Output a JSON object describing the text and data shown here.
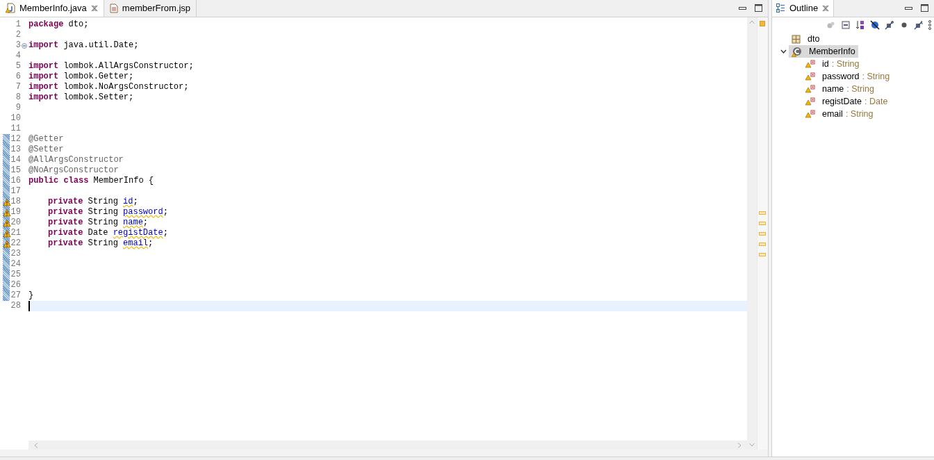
{
  "editor": {
    "tabs": [
      {
        "label": "MemberInfo.java",
        "kind": "java",
        "selected": true,
        "closable": true
      },
      {
        "label": "memberFrom.jsp",
        "kind": "jsp",
        "selected": false,
        "closable": false
      }
    ],
    "lines": [
      {
        "number": "1",
        "tokens": [
          {
            "kind": "keyword",
            "text": "package"
          },
          {
            "kind": "plain",
            "text": " dto;"
          }
        ]
      },
      {
        "number": "2"
      },
      {
        "number": "3",
        "fold": true,
        "tokens": [
          {
            "kind": "keyword",
            "text": "import"
          },
          {
            "kind": "plain",
            "text": " java.util.Date;"
          }
        ]
      },
      {
        "number": "4"
      },
      {
        "number": "5",
        "tokens": [
          {
            "kind": "keyword",
            "text": "import"
          },
          {
            "kind": "plain",
            "text": " lombok.AllArgsConstructor;"
          }
        ]
      },
      {
        "number": "6",
        "tokens": [
          {
            "kind": "keyword",
            "text": "import"
          },
          {
            "kind": "plain",
            "text": " lombok.Getter;"
          }
        ]
      },
      {
        "number": "7",
        "tokens": [
          {
            "kind": "keyword",
            "text": "import"
          },
          {
            "kind": "plain",
            "text": " lombok.NoArgsConstructor;"
          }
        ]
      },
      {
        "number": "8",
        "tokens": [
          {
            "kind": "keyword",
            "text": "import"
          },
          {
            "kind": "plain",
            "text": " lombok.Setter;"
          }
        ]
      },
      {
        "number": "9"
      },
      {
        "number": "10"
      },
      {
        "number": "11"
      },
      {
        "number": "12",
        "changed": true,
        "tokens": [
          {
            "kind": "annotation",
            "text": "@Getter"
          }
        ]
      },
      {
        "number": "13",
        "changed": true,
        "tokens": [
          {
            "kind": "annotation",
            "text": "@Setter"
          }
        ]
      },
      {
        "number": "14",
        "changed": true,
        "tokens": [
          {
            "kind": "annotation",
            "text": "@AllArgsConstructor"
          }
        ]
      },
      {
        "number": "15",
        "changed": true,
        "tokens": [
          {
            "kind": "annotation",
            "text": "@NoArgsConstructor"
          }
        ]
      },
      {
        "number": "16",
        "changed": true,
        "tokens": [
          {
            "kind": "keyword",
            "text": "public class"
          },
          {
            "kind": "plain",
            "text": " MemberInfo {"
          }
        ]
      },
      {
        "number": "17",
        "changed": true
      },
      {
        "number": "18",
        "changed": true,
        "warning": true,
        "indent": true,
        "tokens": [
          {
            "kind": "keyword",
            "text": "private"
          },
          {
            "kind": "plain",
            "text": " String "
          },
          {
            "kind": "field",
            "text": "id"
          },
          {
            "kind": "plain",
            "text": ";"
          }
        ]
      },
      {
        "number": "19",
        "changed": true,
        "warning": true,
        "indent": true,
        "tokens": [
          {
            "kind": "keyword",
            "text": "private"
          },
          {
            "kind": "plain",
            "text": " String "
          },
          {
            "kind": "field",
            "text": "password"
          },
          {
            "kind": "plain",
            "text": ";"
          }
        ]
      },
      {
        "number": "20",
        "changed": true,
        "warning": true,
        "indent": true,
        "tokens": [
          {
            "kind": "keyword",
            "text": "private"
          },
          {
            "kind": "plain",
            "text": " String "
          },
          {
            "kind": "field",
            "text": "name"
          },
          {
            "kind": "plain",
            "text": ";"
          }
        ]
      },
      {
        "number": "21",
        "changed": true,
        "warning": true,
        "indent": true,
        "tokens": [
          {
            "kind": "keyword",
            "text": "private"
          },
          {
            "kind": "plain",
            "text": " Date "
          },
          {
            "kind": "field",
            "text": "registDate"
          },
          {
            "kind": "plain",
            "text": ";"
          }
        ]
      },
      {
        "number": "22",
        "changed": true,
        "warning": true,
        "indent": true,
        "tokens": [
          {
            "kind": "keyword",
            "text": "private"
          },
          {
            "kind": "plain",
            "text": " String "
          },
          {
            "kind": "field",
            "text": "email"
          },
          {
            "kind": "plain",
            "text": ";"
          }
        ]
      },
      {
        "number": "23",
        "changed": true
      },
      {
        "number": "24",
        "changed": true
      },
      {
        "number": "25",
        "changed": true
      },
      {
        "number": "26",
        "changed": true
      },
      {
        "number": "27",
        "changed": true,
        "tokens": [
          {
            "kind": "plain",
            "text": "}"
          }
        ]
      },
      {
        "number": "28",
        "current": true
      }
    ]
  },
  "outline": {
    "title": "Outline",
    "items": [
      {
        "kind": "package",
        "name": "dto",
        "selected": false
      },
      {
        "kind": "class",
        "name": "MemberInfo",
        "selected": true,
        "expanded": true,
        "warning": true,
        "children": [
          {
            "kind": "field",
            "name": "id",
            "type": ": String",
            "selected": false
          },
          {
            "kind": "field",
            "name": "password",
            "type": ": String",
            "selected": false
          },
          {
            "kind": "field",
            "name": "name",
            "type": ": String",
            "selected": false
          },
          {
            "kind": "field",
            "name": "registDate",
            "type": ": Date",
            "selected": false
          },
          {
            "kind": "field",
            "name": "email",
            "type": ": String",
            "selected": false
          }
        ]
      }
    ]
  }
}
